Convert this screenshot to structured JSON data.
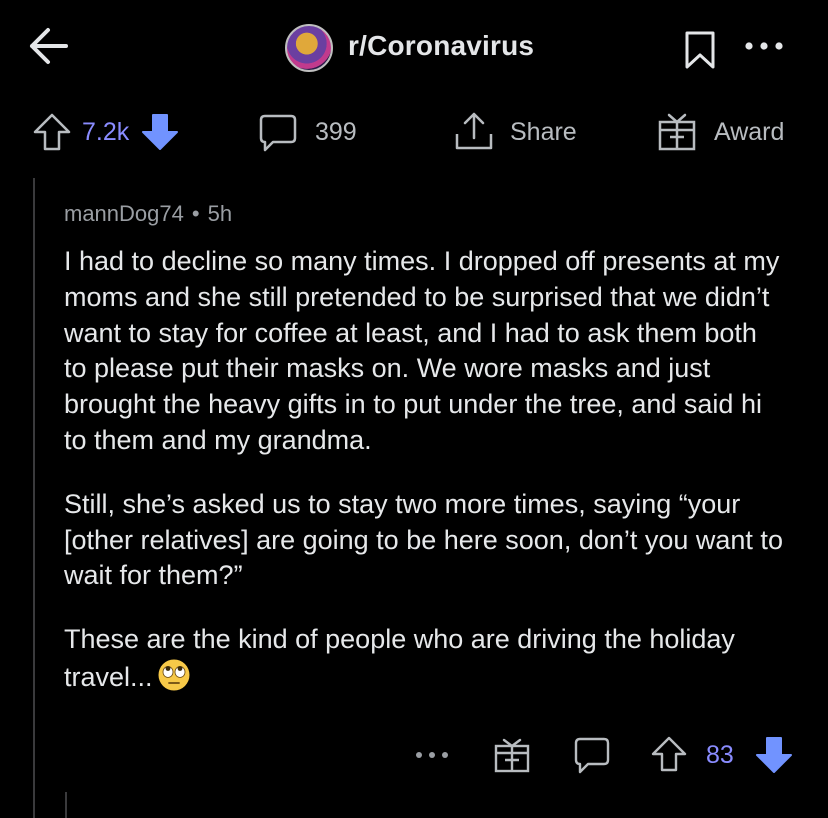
{
  "header": {
    "subreddit": "r/Coronavirus",
    "back_icon": "back-arrow-icon",
    "bookmark_icon": "bookmark-icon",
    "more_icon": "more-icon"
  },
  "post_actions": {
    "upvotes": "7.2k",
    "comments": "399",
    "share_label": "Share",
    "award_label": "Award"
  },
  "comment": {
    "author": "mannDog74",
    "separator": "•",
    "age": "5h",
    "paragraphs": [
      "I had to decline so many times. I dropped off presents at my moms and she still pretended to be surprised that we didn’t want to stay for coffee at least, and I had to ask them both to please put their masks on. We wore masks and just brought the heavy gifts in to put under the tree, and said hi to them and my grandma.",
      "Still, she’s asked us to stay two more times, saying “your [other relatives] are going to be here soon, don’t you want to wait for them?”",
      "These are the kind of people who are driving the holiday travel..."
    ],
    "emoji": "face-with-rolling-eyes",
    "score": "83"
  },
  "colors": {
    "background": "#000000",
    "text": "#e6e8ea",
    "muted": "#9a9ea3",
    "vote_accent": "#8a8cff",
    "downvote": "#7193ff"
  }
}
